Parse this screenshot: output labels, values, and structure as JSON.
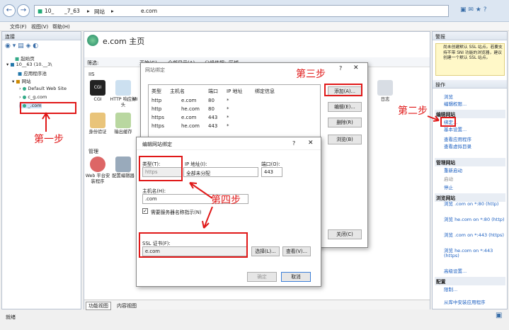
{
  "address": {
    "seg1": "10_",
    "seg2": "_7_63",
    "seg3": "网站",
    "seg4": "e.com"
  },
  "menu": [
    "文件(F)",
    "视图(V)",
    "帮助(H)"
  ],
  "left": {
    "title": "连接",
    "items": [
      "起始页",
      "10_",
      "_63 (10._",
      "_3\\",
      "应用程序池",
      "网站",
      "Default Web Site",
      "c",
      "_g.com",
      "_.com"
    ]
  },
  "main": {
    "title": "e.com 主页",
    "filter_label": "筛选:",
    "start_label": "开始(G)",
    "showall_label": "全部显示(A)",
    "group_label": "分组依据:",
    "group_value": "区域",
    "section_iis": "IIS",
    "section_mgmt": "管理",
    "icons": [
      "CGI",
      "HTTP 响应标头",
      "MI",
      "日志",
      "身份验证",
      "输出缓存",
      "Web 平台安装程序",
      "配置编辑器"
    ],
    "tabs": [
      "功能视图",
      "内容视图"
    ]
  },
  "bindings_dialog": {
    "title": "网站绑定",
    "columns": [
      "类型",
      "主机名",
      "端口",
      "IP 地址",
      "绑定信息"
    ],
    "rows": [
      [
        "http",
        "e.com",
        "80",
        "*"
      ],
      [
        "http",
        "he.com",
        "80",
        "*"
      ],
      [
        "https",
        "e.com",
        "443",
        "*"
      ],
      [
        "https",
        "he.com",
        "443",
        "*"
      ]
    ],
    "buttons": [
      "添加(A)...",
      "编辑(E)...",
      "删除(R)",
      "浏览(B)",
      "关闭(C)"
    ]
  },
  "edit_dialog": {
    "title": "编辑网站绑定",
    "type_label": "类型(T):",
    "type_value": "https",
    "ip_label": "IP 地址(I):",
    "ip_value": "全部未分配",
    "port_label": "端口(O):",
    "port_value": "443",
    "host_label": "主机名(H):",
    "host_value": ".com",
    "sni_label": "需要服务器名称指示(N)",
    "ssl_label": "SSL 证书(F):",
    "ssl_value": "e.com",
    "select_btn": "选择(L)...",
    "view_btn": "查看(V)...",
    "ok": "确定",
    "cancel": "取消"
  },
  "right": {
    "title": "警报",
    "alert": "尚未创建默认 SSL 站点。若要支持不带 SNI 功能的浏览器，建议创建一个默认 SSL 站点。",
    "ops": "操作",
    "items": [
      "浏览",
      "编辑权限...",
      "编辑网站",
      "绑定...",
      "基本设置...",
      "查看应用程序",
      "查看虚拟目录",
      "管理网站",
      "重新启动",
      "启动",
      "停止",
      "浏览网站",
      "浏览 .com on *:80 (http)",
      "浏览 he.com on *:80 (http)",
      "浏览 .com on *:443 (https)",
      "浏览 he.com on *:443 (https)",
      "高级设置...",
      "配置",
      "限制...",
      "从库中安装应用程序"
    ]
  },
  "steps": [
    "第一步",
    "第二步",
    "第三步",
    "第四步"
  ],
  "status": "就绪"
}
